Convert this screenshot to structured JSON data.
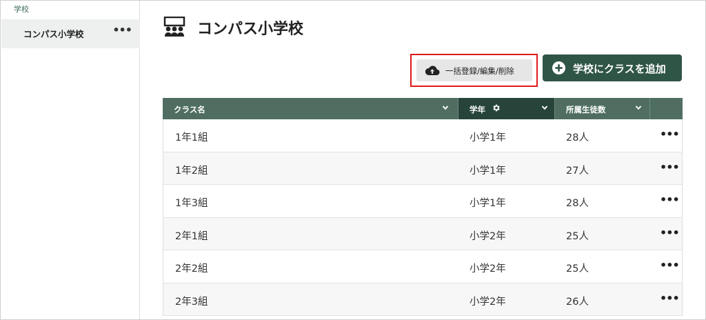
{
  "sidebar": {
    "section_label": "学校",
    "items": [
      {
        "label": "コンパス小学校",
        "more": "•••"
      }
    ]
  },
  "header": {
    "title": "コンパス小学校",
    "icon": "classroom-icon"
  },
  "toolbar": {
    "bulk_label": "一括登録/編集/削除",
    "bulk_icon": "cloud-upload-icon",
    "add_label": "学校にクラスを追加",
    "add_icon": "plus-circle-icon",
    "highlight_color": "#e01818",
    "accent_color": "#2f5546"
  },
  "table": {
    "columns": [
      {
        "label": "クラス名"
      },
      {
        "label": "学年"
      },
      {
        "label": "所属生徒数"
      },
      {
        "label": ""
      }
    ],
    "rows": [
      {
        "name": "1年1組",
        "grade": "小学1年",
        "count": "28人"
      },
      {
        "name": "1年2組",
        "grade": "小学1年",
        "count": "27人"
      },
      {
        "name": "1年3組",
        "grade": "小学1年",
        "count": "28人"
      },
      {
        "name": "2年1組",
        "grade": "小学2年",
        "count": "25人"
      },
      {
        "name": "2年2組",
        "grade": "小学2年",
        "count": "25人"
      },
      {
        "name": "2年3組",
        "grade": "小学2年",
        "count": "26人"
      }
    ],
    "row_more": "•••"
  }
}
